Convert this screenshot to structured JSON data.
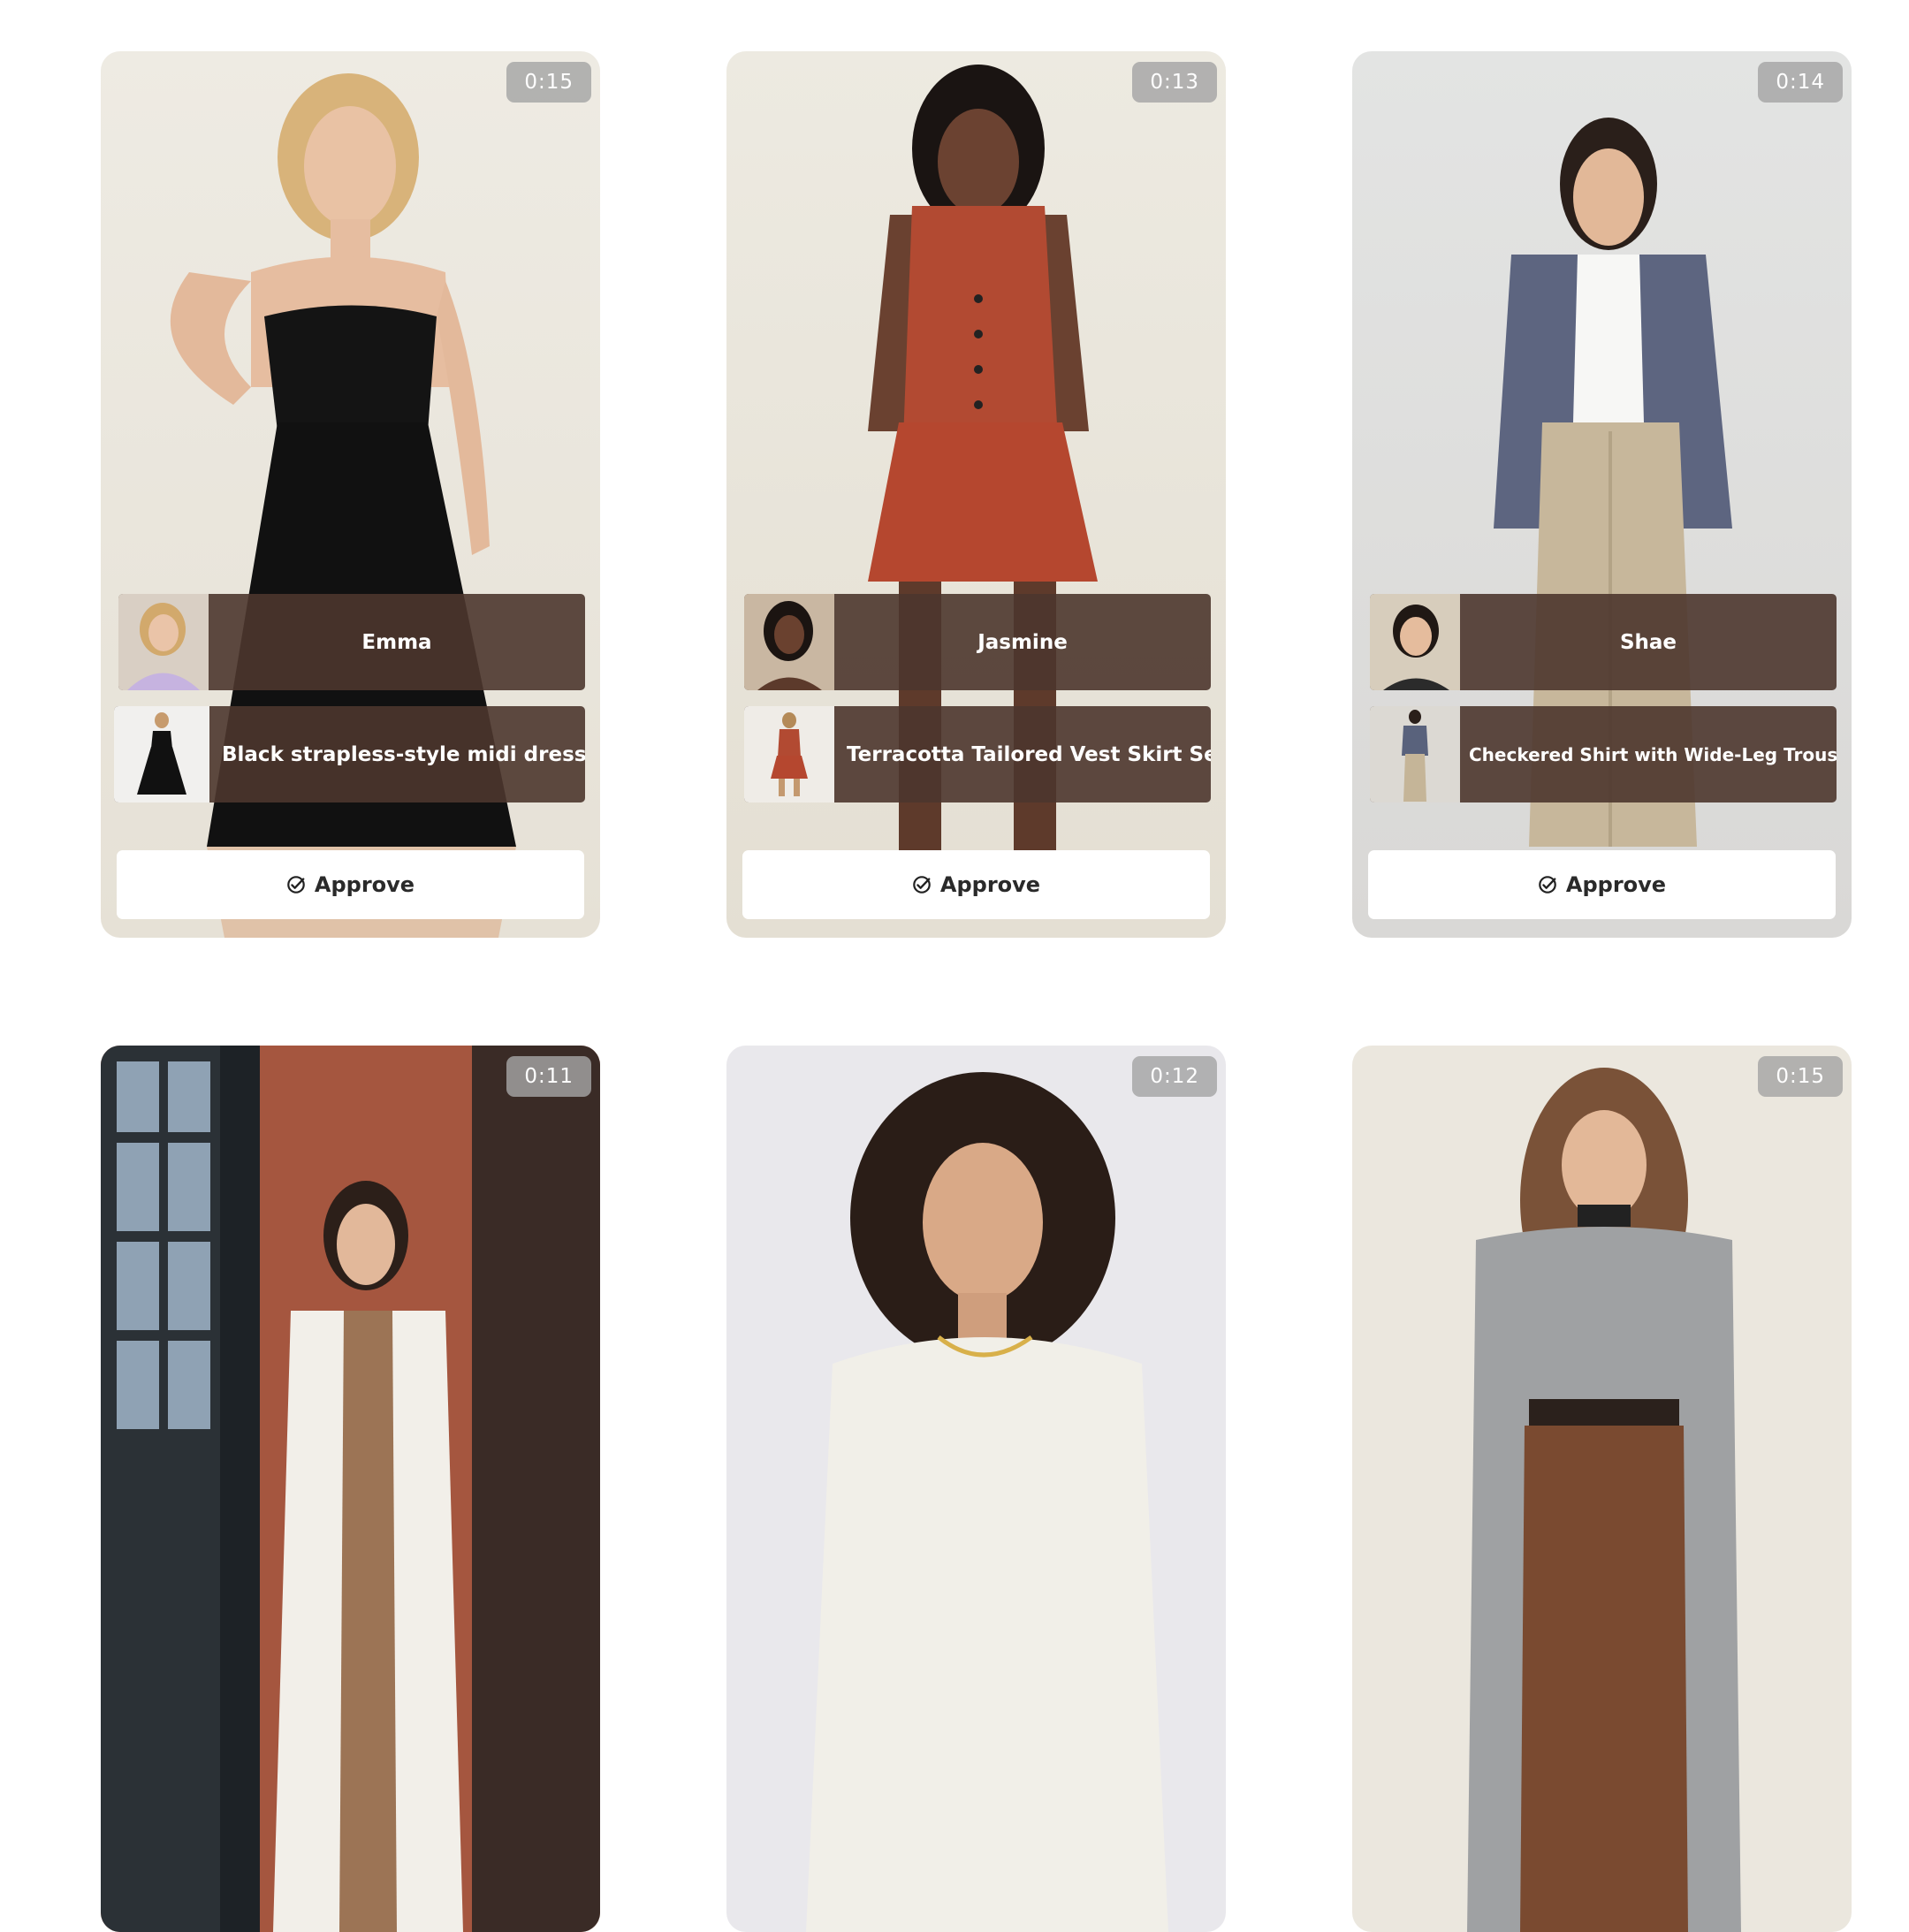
{
  "cards": [
    {
      "duration": "0:15",
      "model": "Emma",
      "product": "Black strapless-style midi dress",
      "approve": "Approve"
    },
    {
      "duration": "0:13",
      "model": "Jasmine",
      "product": "Terracotta Tailored Vest Skirt Set",
      "approve": "Approve"
    },
    {
      "duration": "0:14",
      "model": "Shae",
      "product": "Checkered Shirt with Wide-Leg Trousers",
      "approve": "Approve"
    },
    {
      "duration": "0:11"
    },
    {
      "duration": "0:12"
    },
    {
      "duration": "0:15"
    }
  ],
  "colors": {
    "overlay": "#4c362d",
    "duration_badge": "#a5a5a5",
    "approve_bg": "#ffffff"
  },
  "icons": {
    "approve": "check-circle-icon"
  }
}
